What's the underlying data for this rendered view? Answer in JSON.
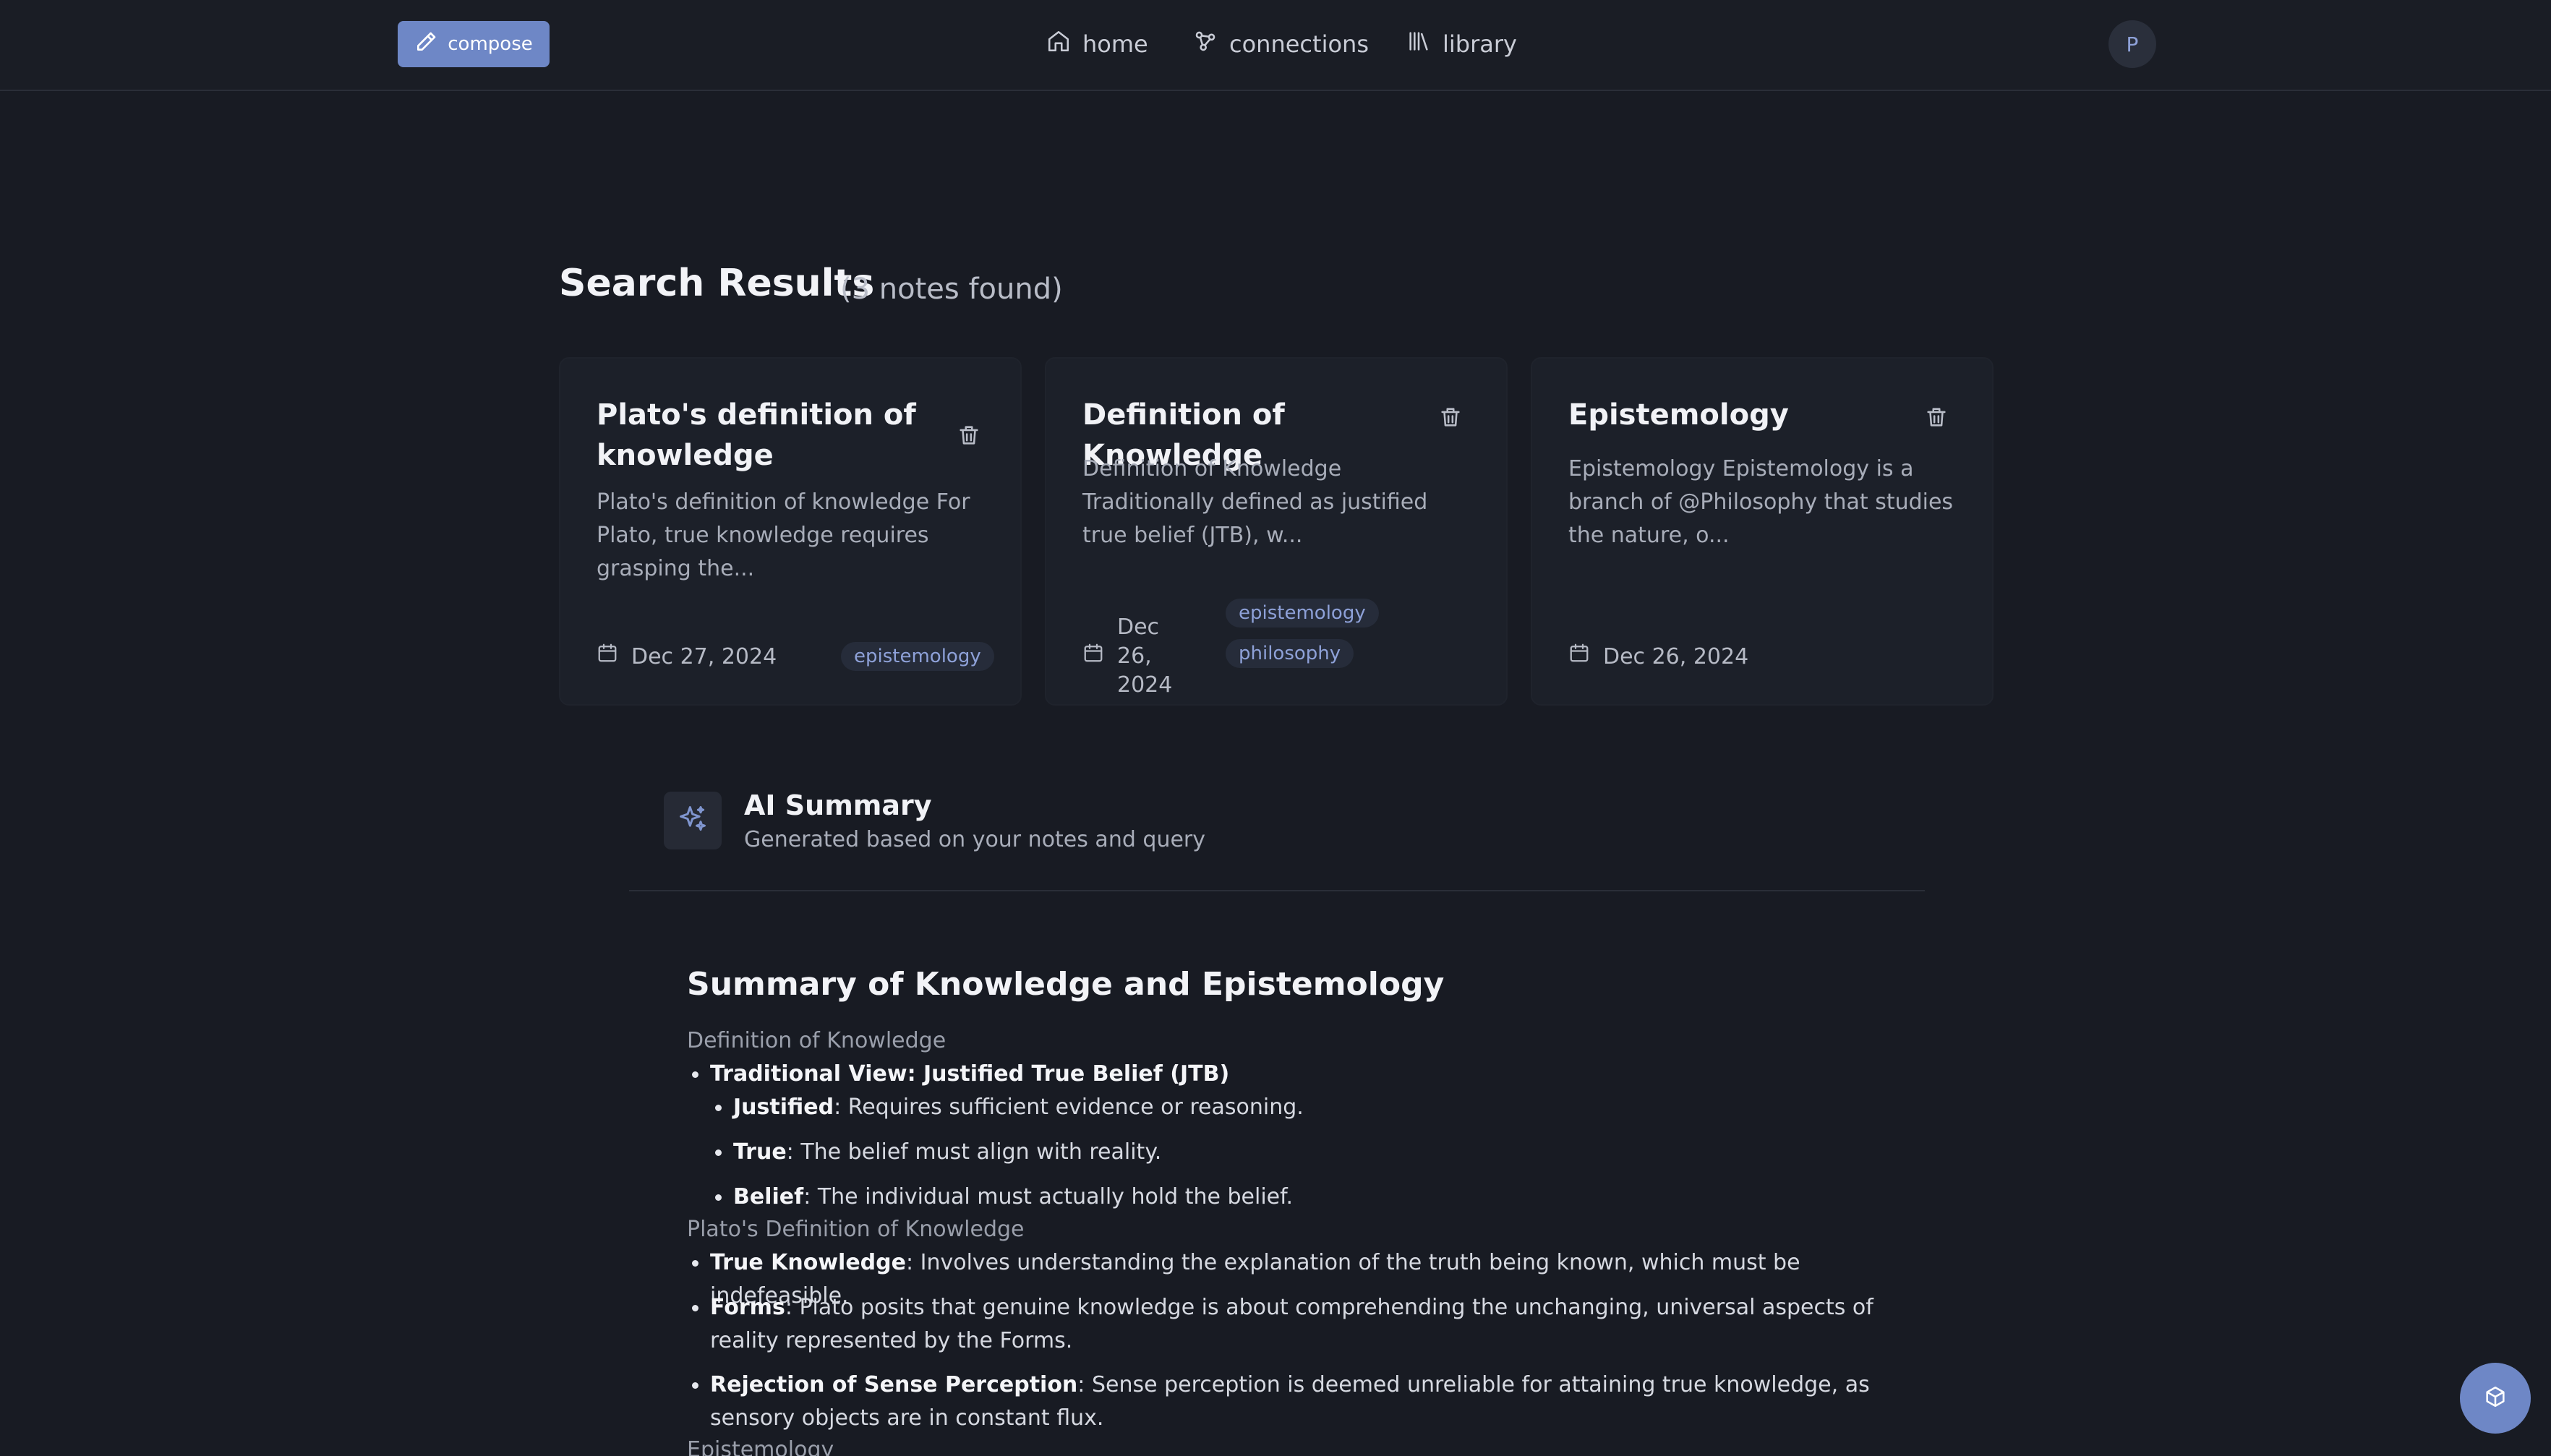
{
  "topbar": {
    "compose_label": "compose",
    "nav": {
      "home": "home",
      "connections": "connections",
      "library": "library"
    },
    "avatar_initial": "P"
  },
  "results": {
    "title": "Search Results",
    "count": "(3 notes found)"
  },
  "cards": [
    {
      "title": "Plato's definition of knowledge",
      "excerpt": "Plato's definition of knowledge For Plato, true knowledge requires grasping the...",
      "date": "Dec 27, 2024",
      "tags": [
        "epistemology"
      ]
    },
    {
      "title": "Definition of Knowledge",
      "excerpt": "Definition of Knowledge Traditionally defined as justified true belief (JTB), w...",
      "date": "Dec 26, 2024",
      "tags": [
        "epistemology",
        "philosophy"
      ]
    },
    {
      "title": "Epistemology",
      "excerpt": "Epistemology Epistemology is a branch of @Philosophy that studies the nature, o...",
      "date": "Dec 26, 2024",
      "tags": []
    }
  ],
  "ai_summary": {
    "title": "AI Summary",
    "subtitle": "Generated based on your notes and query",
    "heading": "Summary of Knowledge and Epistemology",
    "sections": [
      {
        "title": "Definition of Knowledge",
        "items": [
          {
            "bold": "Traditional View: Justified True Belief (JTB)",
            "text": ""
          },
          {
            "bold": "Justified",
            "text": ": Requires sufficient evidence or reasoning."
          },
          {
            "bold": "True",
            "text": ": The belief must align with reality."
          },
          {
            "bold": "Belief",
            "text": ": The individual must actually hold the belief."
          }
        ]
      },
      {
        "title": "Plato's Definition of Knowledge",
        "items": [
          {
            "bold": "True Knowledge",
            "text": ": Involves understanding the explanation of the truth being known, which must be indefeasible."
          },
          {
            "bold": "Forms",
            "text": ": Plato posits that genuine knowledge is about comprehending the unchanging, universal aspects of reality represented by the Forms."
          },
          {
            "bold": "Rejection of Sense Perception",
            "text": ": Sense perception is deemed unreliable for attaining true knowledge, as sensory objects are in constant flux."
          }
        ]
      },
      {
        "title": "Epistemology",
        "items": []
      }
    ]
  },
  "icons": {
    "compose": "pencil-icon",
    "home": "home-icon",
    "connections": "network-icon",
    "library": "library-icon",
    "delete": "trash-icon",
    "date": "calendar-icon",
    "ai": "sparkles-icon",
    "fab": "cube-icon"
  },
  "colors": {
    "background": "#181b23",
    "accent": "#6e87c6",
    "card": "#1c2029",
    "tag_text": "#8ea1d8"
  }
}
